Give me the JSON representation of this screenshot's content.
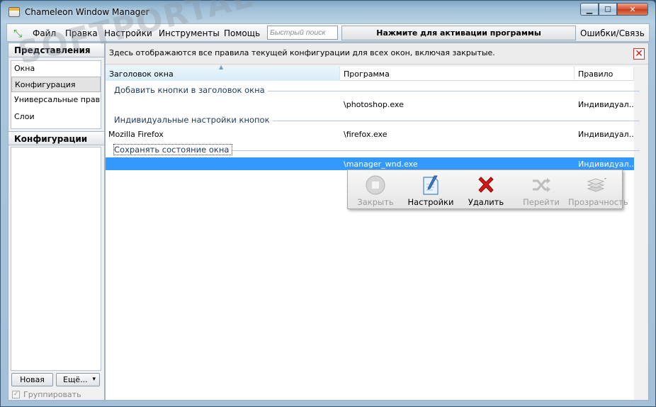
{
  "window": {
    "title": "Chameleon Window Manager"
  },
  "menu": {
    "items": [
      "Файл",
      "Правка",
      "Настройки",
      "Инструменты",
      "Помощь"
    ],
    "search_placeholder": "Быстрый поиск",
    "activate_label": "Нажмите для активации программы",
    "errors_label": "Ошибки/Связь"
  },
  "sidebar": {
    "views_header": "Представления",
    "views": [
      "Окна",
      "Конфигурация",
      "Универсальные правила",
      "Слои"
    ],
    "active_view": 1,
    "configs_header": "Конфигурации",
    "new_label": "Новая",
    "more_label": "Ещё...",
    "more_arrow": "▾",
    "group_label": "Группировать"
  },
  "main": {
    "info_text": "Здесь отображаются все правила текущей конфигурации для всех окон, включая закрытые.",
    "columns": [
      "Заголовок окна",
      "Программа",
      "Правило"
    ],
    "groups": [
      {
        "label": "Добавить кнопки в заголовок окна",
        "rows": [
          {
            "title": "",
            "program": "\\photoshop.exe",
            "rule": "Индивидуал..."
          }
        ]
      },
      {
        "label": "Индивидуальные настройки кнопок",
        "rows": [
          {
            "title": "Mozilla Firefox",
            "program": "\\firefox.exe",
            "rule": "Индивидуал..."
          }
        ]
      },
      {
        "label": "Сохранять состояние окна",
        "rows": [
          {
            "title": "",
            "program": "\\manager_wnd.exe",
            "rule": "Индивидуал..."
          }
        ]
      }
    ]
  },
  "toolbar": {
    "close_label": "Закрыть",
    "settings_label": "Настройки",
    "delete_label": "Удалить",
    "goto_label": "Перейти",
    "transparency_label": "Прозрачность"
  },
  "watermark": "SOFTPORTAL",
  "colors": {
    "selection": "#3399ff",
    "group_text": "#1e395b",
    "delete_red": "#d01818"
  }
}
